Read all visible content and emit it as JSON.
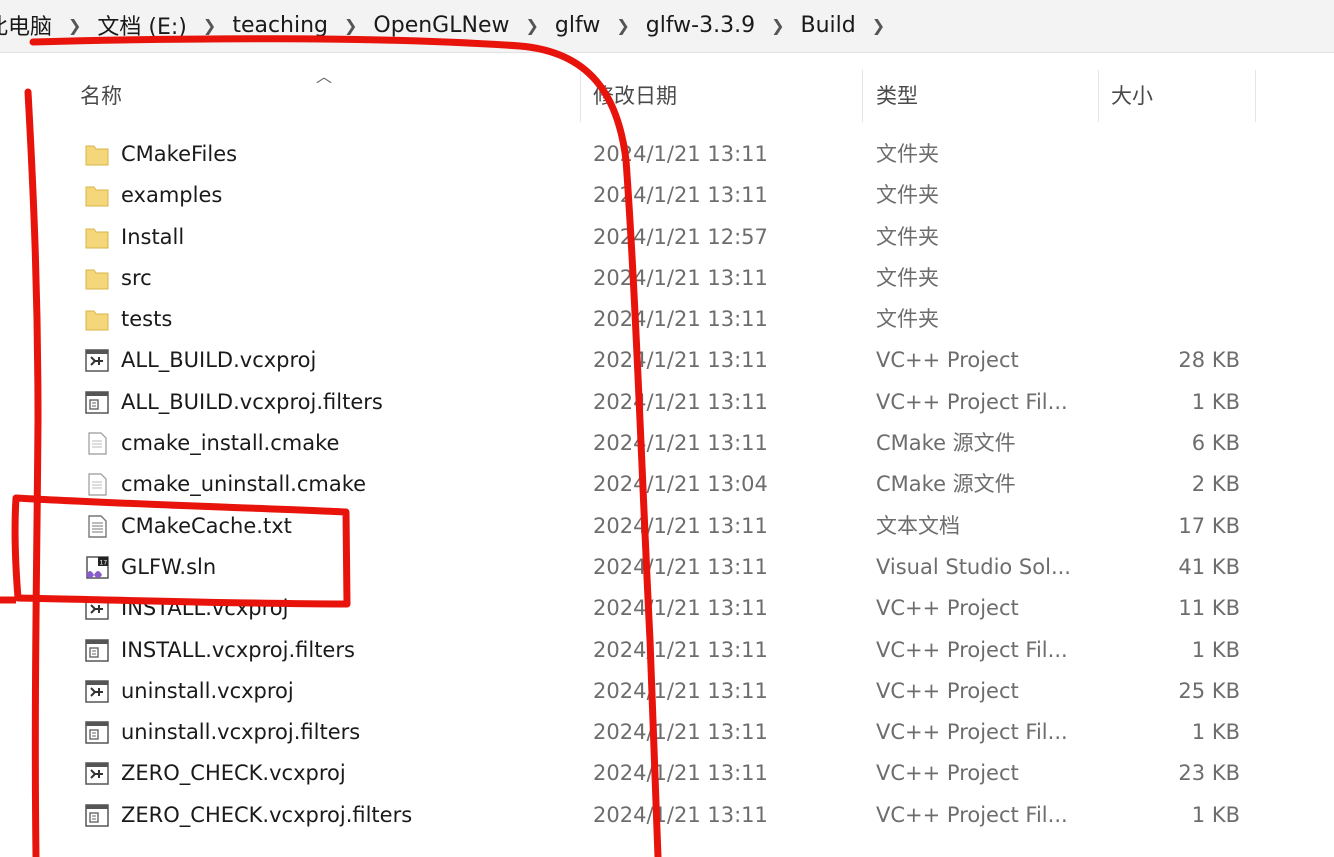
{
  "breadcrumb": {
    "items": [
      "此电脑",
      "文档 (E:)",
      "teaching",
      "OpenGLNew",
      "glfw",
      "glfw-3.3.9",
      "Build"
    ]
  },
  "columns": {
    "name": "名称",
    "date": "修改日期",
    "type": "类型",
    "size": "大小"
  },
  "files": [
    {
      "name": "CMakeFiles",
      "date": "2024/1/21 13:11",
      "type": "文件夹",
      "size": "",
      "icon": "folder-icon"
    },
    {
      "name": "examples",
      "date": "2024/1/21 13:11",
      "type": "文件夹",
      "size": "",
      "icon": "folder-icon"
    },
    {
      "name": "Install",
      "date": "2024/1/21 12:57",
      "type": "文件夹",
      "size": "",
      "icon": "folder-icon"
    },
    {
      "name": "src",
      "date": "2024/1/21 13:11",
      "type": "文件夹",
      "size": "",
      "icon": "folder-icon"
    },
    {
      "name": "tests",
      "date": "2024/1/21 13:11",
      "type": "文件夹",
      "size": "",
      "icon": "folder-icon"
    },
    {
      "name": "ALL_BUILD.vcxproj",
      "date": "2024/1/21 13:11",
      "type": "VC++ Project",
      "size": "28 KB",
      "icon": "vcxproj-icon"
    },
    {
      "name": "ALL_BUILD.vcxproj.filters",
      "date": "2024/1/21 13:11",
      "type": "VC++ Project Fil...",
      "size": "1 KB",
      "icon": "filters-icon"
    },
    {
      "name": "cmake_install.cmake",
      "date": "2024/1/21 13:11",
      "type": "CMake 源文件",
      "size": "6 KB",
      "icon": "cmake-file-icon"
    },
    {
      "name": "cmake_uninstall.cmake",
      "date": "2024/1/21 13:04",
      "type": "CMake 源文件",
      "size": "2 KB",
      "icon": "cmake-file-icon"
    },
    {
      "name": "CMakeCache.txt",
      "date": "2024/1/21 13:11",
      "type": "文本文档",
      "size": "17 KB",
      "icon": "text-file-icon"
    },
    {
      "name": "GLFW.sln",
      "date": "2024/1/21 13:11",
      "type": "Visual Studio Sol...",
      "size": "41 KB",
      "icon": "vs-solution-icon"
    },
    {
      "name": "INSTALL.vcxproj",
      "date": "2024/1/21 13:11",
      "type": "VC++ Project",
      "size": "11 KB",
      "icon": "vcxproj-icon"
    },
    {
      "name": "INSTALL.vcxproj.filters",
      "date": "2024/1/21 13:11",
      "type": "VC++ Project Fil...",
      "size": "1 KB",
      "icon": "filters-icon"
    },
    {
      "name": "uninstall.vcxproj",
      "date": "2024/1/21 13:11",
      "type": "VC++ Project",
      "size": "25 KB",
      "icon": "vcxproj-icon"
    },
    {
      "name": "uninstall.vcxproj.filters",
      "date": "2024/1/21 13:11",
      "type": "VC++ Project Fil...",
      "size": "1 KB",
      "icon": "filters-icon"
    },
    {
      "name": "ZERO_CHECK.vcxproj",
      "date": "2024/1/21 13:11",
      "type": "VC++ Project",
      "size": "23 KB",
      "icon": "vcxproj-icon"
    },
    {
      "name": "ZERO_CHECK.vcxproj.filters",
      "date": "2024/1/21 13:11",
      "type": "VC++ Project Fil...",
      "size": "1 KB",
      "icon": "filters-icon"
    }
  ],
  "colors": {
    "annotation": "#e8140c",
    "folder": "#f5d77b"
  }
}
